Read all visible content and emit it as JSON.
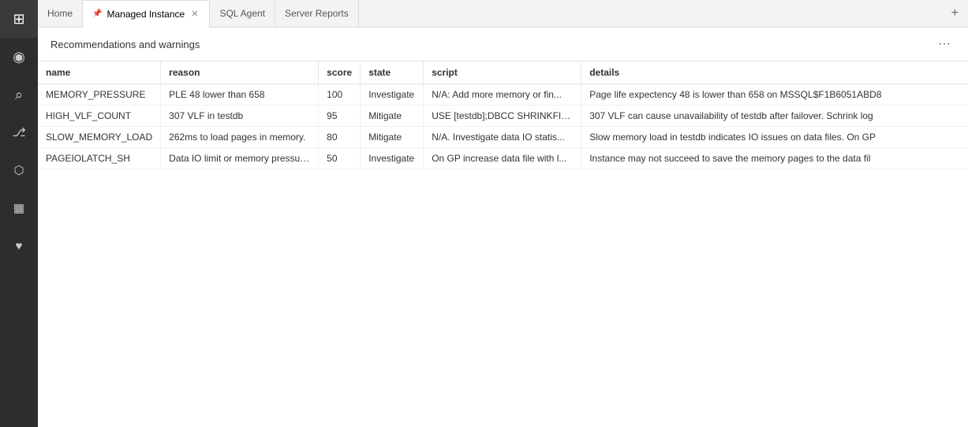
{
  "activityBar": {
    "items": [
      {
        "id": "home",
        "icon": "⊞",
        "label": "Home",
        "active": false
      },
      {
        "id": "connections",
        "icon": "◎",
        "label": "Connections",
        "active": false
      },
      {
        "id": "search",
        "icon": "🔍",
        "label": "Search",
        "active": false
      },
      {
        "id": "git",
        "icon": "⎇",
        "label": "Source Control",
        "active": false
      },
      {
        "id": "servers",
        "icon": "🗄",
        "label": "Servers",
        "active": false
      },
      {
        "id": "dashboard",
        "icon": "⊞",
        "label": "Dashboard",
        "active": false
      },
      {
        "id": "monitor",
        "icon": "♥",
        "label": "Monitor",
        "active": false
      }
    ]
  },
  "tabs": [
    {
      "id": "home",
      "label": "Home",
      "active": false,
      "closable": false,
      "pinned": false
    },
    {
      "id": "managed-instance",
      "label": "Managed Instance",
      "active": true,
      "closable": true,
      "pinned": true
    },
    {
      "id": "sql-agent",
      "label": "SQL Agent",
      "active": false,
      "closable": false,
      "pinned": false
    },
    {
      "id": "server-reports",
      "label": "Server Reports",
      "active": false,
      "closable": false,
      "pinned": false
    }
  ],
  "addTabLabel": "+",
  "section": {
    "title": "Recommendations and warnings",
    "moreLabel": "···"
  },
  "table": {
    "columns": [
      {
        "id": "name",
        "label": "name"
      },
      {
        "id": "reason",
        "label": "reason"
      },
      {
        "id": "score",
        "label": "score"
      },
      {
        "id": "state",
        "label": "state"
      },
      {
        "id": "script",
        "label": "script"
      },
      {
        "id": "details",
        "label": "details"
      }
    ],
    "rows": [
      {
        "name": "MEMORY_PRESSURE",
        "reason": "PLE 48 lower than 658",
        "score": "100",
        "state": "Investigate",
        "script": "N/A: Add more memory or fin...",
        "details": "Page life expectency 48 is lower than 658 on MSSQL$F1B6051ABD8"
      },
      {
        "name": "HIGH_VLF_COUNT",
        "reason": "307 VLF in testdb",
        "score": "95",
        "state": "Mitigate",
        "script": "USE [testdb];DBCC SHRINKFIL...",
        "details": "307 VLF can cause unavailability of testdb after failover. Schrink log"
      },
      {
        "name": "SLOW_MEMORY_LOAD",
        "reason": "262ms to load pages in memory.",
        "score": "80",
        "state": "Mitigate",
        "script": "N/A. Investigate data IO statis...",
        "details": "Slow memory load in testdb indicates IO issues on data files. On GP"
      },
      {
        "name": "PAGEIOLATCH_SH",
        "reason": "Data IO limit or memory pressure.",
        "score": "50",
        "state": "Investigate",
        "script": "On GP increase data file with l...",
        "details": "Instance may not succeed to save the memory pages to the data fil"
      }
    ]
  }
}
